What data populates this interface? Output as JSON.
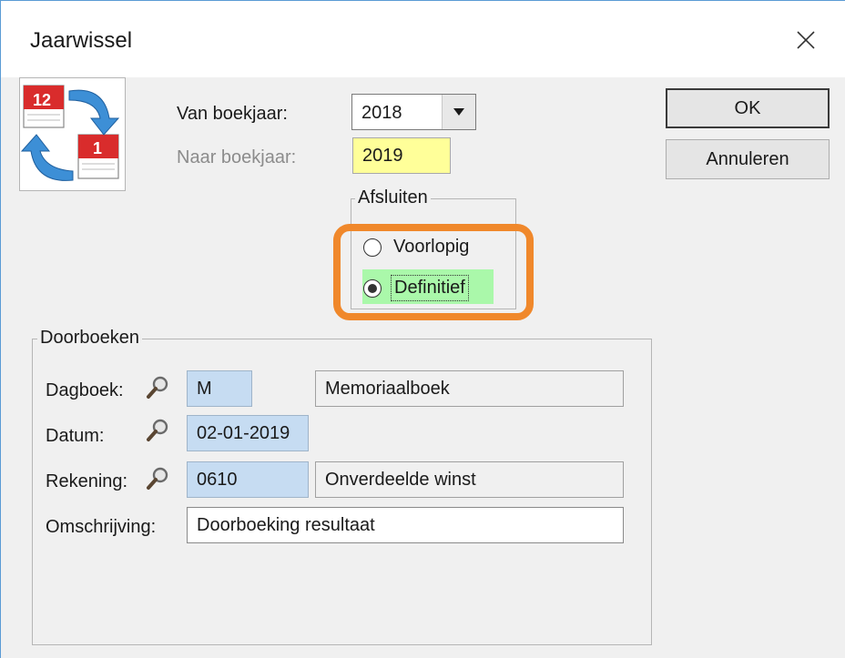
{
  "window": {
    "title": "Jaarwissel"
  },
  "fields": {
    "van_boekjaar_label": "Van boekjaar:",
    "van_boekjaar_value": "2018",
    "naar_boekjaar_label": "Naar boekjaar:",
    "naar_boekjaar_value": "2019"
  },
  "buttons": {
    "ok": "OK",
    "cancel": "Annuleren"
  },
  "afsluiten": {
    "title": "Afsluiten",
    "options": [
      {
        "label": "Voorlopig",
        "selected": false
      },
      {
        "label": "Definitief",
        "selected": true
      }
    ]
  },
  "doorboeken": {
    "title": "Doorboeken",
    "dagboek_label": "Dagboek:",
    "dagboek_code": "M",
    "dagboek_name": "Memoriaalboek",
    "datum_label": "Datum:",
    "datum_value": "02-01-2019",
    "rekening_label": "Rekening:",
    "rekening_code": "0610",
    "rekening_name": "Onverdeelde winst",
    "omschrijving_label": "Omschrijving:",
    "omschrijving_value": "Doorboeking resultaat"
  },
  "colors": {
    "highlight_orange": "#f0882b",
    "required_yellow": "#ffff99",
    "lookup_blue": "#c6dcf2",
    "selected_green": "#aaf8aa"
  },
  "icons": {
    "app": "calendar-year-rollover-icon",
    "close": "close-icon",
    "dropdown": "chevron-down-icon",
    "lookup": "magnifier-icon"
  }
}
